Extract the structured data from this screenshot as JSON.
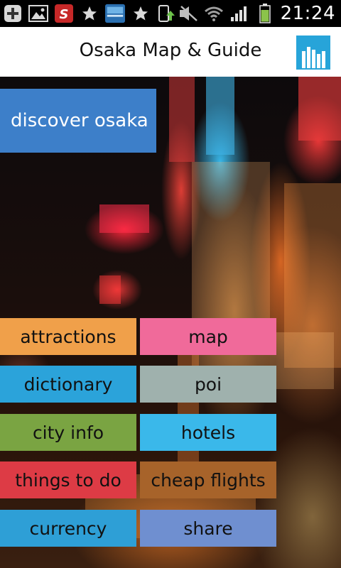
{
  "status_bar": {
    "time": "21:24",
    "icons": [
      "add-icon",
      "image-icon",
      "app-s-icon",
      "star-icon",
      "app-thumbnail-icon",
      "star-icon",
      "phone-upload-icon",
      "mute-icon",
      "wifi-icon",
      "signal-icon",
      "battery-icon"
    ]
  },
  "action_bar": {
    "title": "Osaka Map & Guide",
    "app_icon": "bar-chart-icon",
    "app_icon_color": "#27a4d9"
  },
  "banner": {
    "label": "discover osaka",
    "color": "#3d7fc9"
  },
  "tiles": [
    {
      "label": "attractions",
      "color": "#f0a04a"
    },
    {
      "label": "map",
      "color": "#f06a9a"
    },
    {
      "label": "dictionary",
      "color": "#2ba3da"
    },
    {
      "label": "poi",
      "color": "#9fb1ad"
    },
    {
      "label": "city info",
      "color": "#7aa442"
    },
    {
      "label": "hotels",
      "color": "#3ab8ea"
    },
    {
      "label": "things to do",
      "color": "#dd3b45"
    },
    {
      "label": "cheap flights",
      "color": "#a7632a"
    },
    {
      "label": "currency",
      "color": "#2e9fd6"
    },
    {
      "label": "share",
      "color": "#6f8fd0"
    }
  ]
}
